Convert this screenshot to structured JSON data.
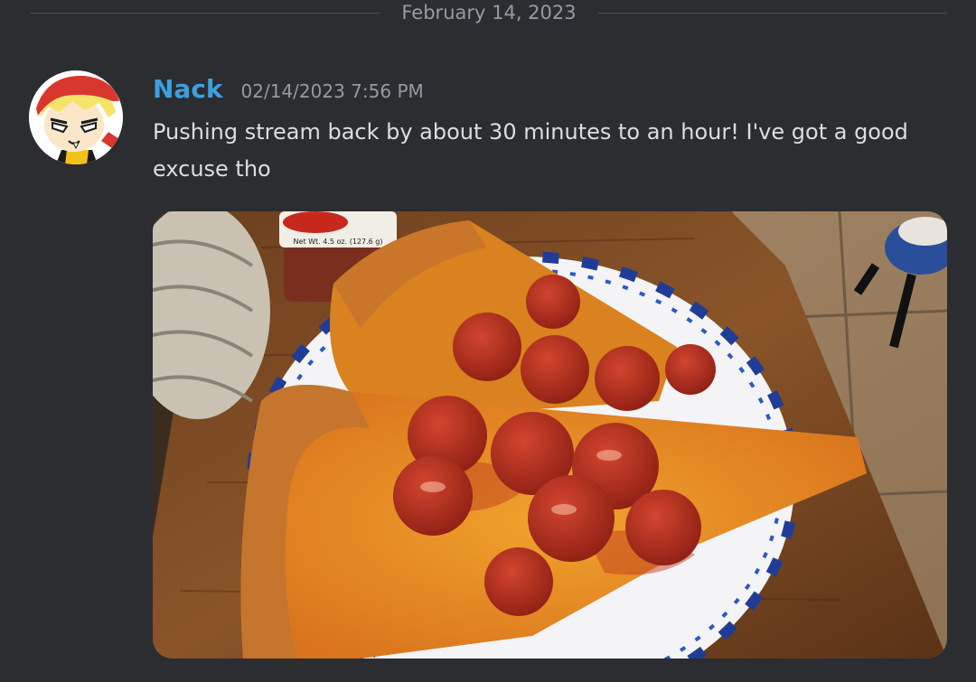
{
  "divider": {
    "date": "February 14, 2023"
  },
  "message": {
    "author": "Nack",
    "timestamp": "02/14/2023 7:56 PM",
    "text": "Pushing stream back by about 30 minutes to an hour! I've got a good excuse tho",
    "author_color": "#3ca0e0",
    "attachment": {
      "jar_label": "Net Wt. 4.5 oz. (127.6 g)",
      "subject": "pepperoni-pizza-photo"
    }
  }
}
